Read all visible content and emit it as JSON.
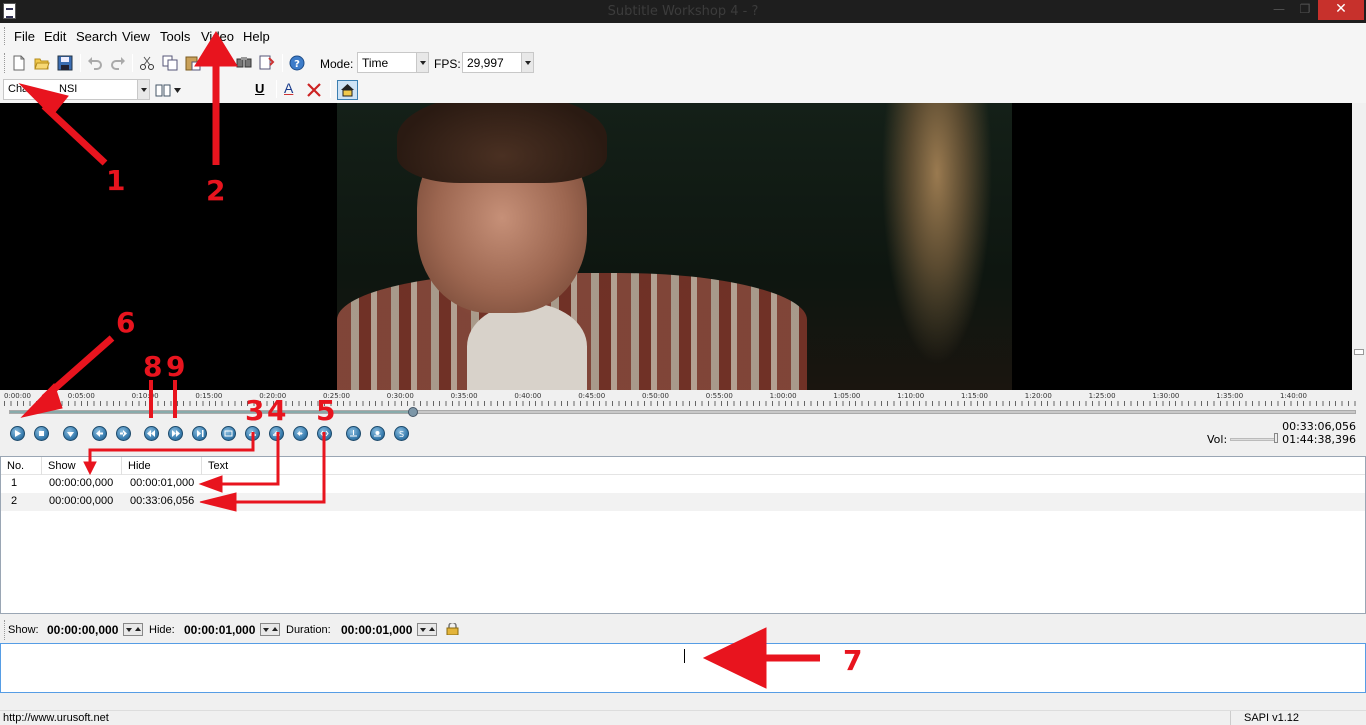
{
  "window": {
    "title": "Subtitle Workshop 4 - ?",
    "minimize": "—",
    "maximize": "❐",
    "close": "✕"
  },
  "menu": [
    "File",
    "Edit",
    "Search",
    "View",
    "Tools",
    "Video",
    "Help"
  ],
  "toolbar": {
    "mode_label": "Mode:",
    "mode_value": "Time",
    "fps_label": "FPS:",
    "fps_value": "29,997",
    "charset_value": "Cha              NSI",
    "underline": "U",
    "font_color": "A"
  },
  "timeline": {
    "ticks": [
      "0:00:00",
      "0:05:00",
      "0:10:00",
      "0:15:00",
      "0:20:00",
      "0:25:00",
      "0:30:00",
      "0:35:00",
      "0:40:00",
      "0:45:00",
      "0:50:00",
      "0:55:00",
      "1:00:00",
      "1:05:00",
      "1:10:00",
      "1:15:00",
      "1:20:00",
      "1:25:00",
      "1:30:00",
      "1:35:00",
      "1:40:00"
    ],
    "progress": 0.3
  },
  "player": {
    "current_time": "00:33:06,056",
    "total_time": "01:44:38,396",
    "volume_label": "Vol:",
    "volume_level": 0.95
  },
  "list": {
    "columns": [
      "No.",
      "Show",
      "Hide",
      "Text"
    ],
    "rows": [
      {
        "no": "1",
        "show": "00:00:00,000",
        "hide": "00:00:01,000",
        "text": ""
      },
      {
        "no": "2",
        "show": "00:00:00,000",
        "hide": "00:33:06,056",
        "text": ""
      }
    ]
  },
  "edit": {
    "show_label": "Show:",
    "show_value": "00:00:00,000",
    "hide_label": "Hide:",
    "hide_value": "00:00:01,000",
    "duration_label": "Duration:",
    "duration_value": "00:00:01,000"
  },
  "status": {
    "left": "http://www.urusoft.net",
    "right": "SAPI v1.12"
  },
  "annotations": [
    "1",
    "2",
    "3",
    "4",
    "5",
    "6",
    "7",
    "8",
    "9"
  ],
  "colors": {
    "annotation": "#e8141e",
    "titlebar": "#1e1e1e",
    "close": "#c7312c"
  }
}
